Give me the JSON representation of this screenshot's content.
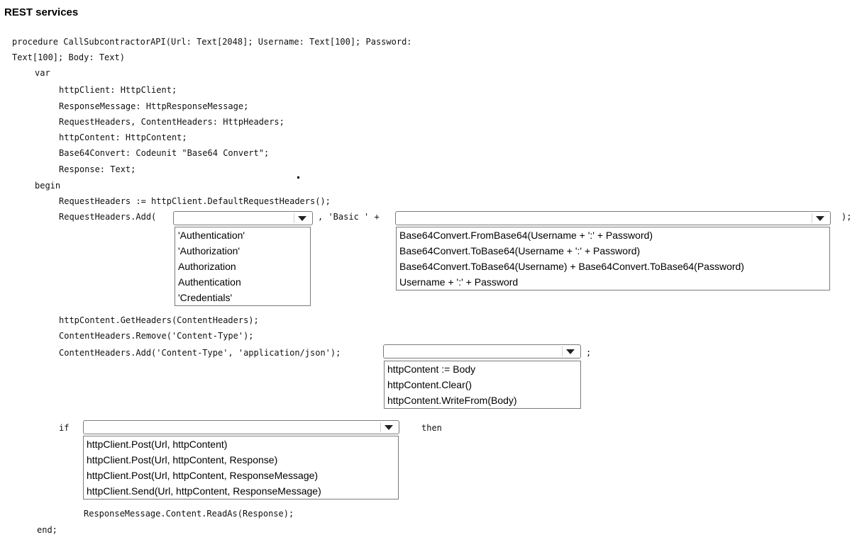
{
  "title": "REST services",
  "code": {
    "line1": "procedure CallSubcontractorAPI(Url: Text[2048]; Username: Text[100]; Password:",
    "line2": "Text[100]; Body: Text)",
    "var": "var",
    "v1": "httpClient: HttpClient;",
    "v2": "ResponseMessage: HttpResponseMessage;",
    "v3": "RequestHeaders, ContentHeaders: HttpHeaders;",
    "v4": "httpContent: HttpContent;",
    "v5": "Base64Convert: Codeunit \"Base64 Convert\";",
    "v6": "Response: Text;",
    "begin": "begin",
    "b1": "RequestHeaders := httpClient.DefaultRequestHeaders();",
    "b2": "RequestHeaders.Add(",
    "b2_mid": ", 'Basic ' +",
    "b2_end": ");",
    "c1": "httpContent.GetHeaders(ContentHeaders);",
    "c2": "ContentHeaders.Remove('Content-Type');",
    "c3": "ContentHeaders.Add('Content-Type', 'application/json');",
    "c3_end": ";",
    "if_kw": "if",
    "then_kw": "then",
    "r1": "ResponseMessage.Content.ReadAs(Response);",
    "end": "end;"
  },
  "dropdowns": {
    "header_name": {
      "selected": "",
      "options": [
        "'Authentication'",
        "'Authorization'",
        "Authorization",
        "Authentication",
        "'Credentials'"
      ]
    },
    "header_value": {
      "selected": "",
      "options": [
        "Base64Convert.FromBase64(Username + ':' + Password)",
        "Base64Convert.ToBase64(Username + ':' + Password)",
        "Base64Convert.ToBase64(Username) + Base64Convert.ToBase64(Password)",
        "Username + ':' + Password"
      ]
    },
    "content_body": {
      "selected": "",
      "options": [
        "httpContent := Body",
        "httpContent.Clear()",
        "httpContent.WriteFrom(Body)"
      ]
    },
    "post_call": {
      "selected": "",
      "options": [
        "httpClient.Post(Url, httpContent)",
        "httpClient.Post(Url, httpContent, Response)",
        "httpClient.Post(Url, httpContent, ResponseMessage)",
        "httpClient.Send(Url, httpContent, ResponseMessage)"
      ]
    }
  }
}
